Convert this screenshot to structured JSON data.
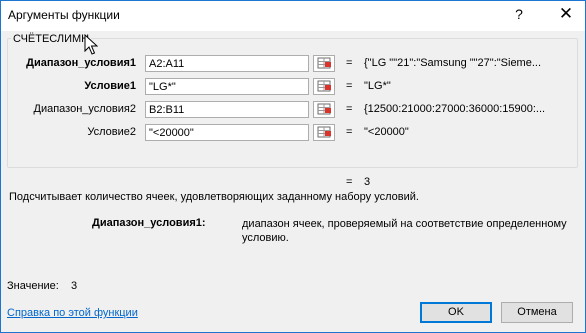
{
  "window": {
    "title": "Аргументы функции",
    "help_glyph": "?",
    "close_glyph": "✕"
  },
  "function": {
    "name": "СЧЁТЕСЛИМН"
  },
  "arguments": [
    {
      "label": "Диапазон_условия1",
      "bold": true,
      "input": "A2:A11",
      "eq": "=",
      "value": "{\"LG \"\"21\":\"Samsung \"\"27\":\"Sieme..."
    },
    {
      "label": "Условие1",
      "bold": true,
      "input": "\"LG*\"",
      "eq": "=",
      "value": "\"LG*\""
    },
    {
      "label": "Диапазон_условия2",
      "bold": false,
      "input": "B2:B11",
      "eq": "=",
      "value": "{12500:21000:27000:36000:15900:..."
    },
    {
      "label": "Условие2",
      "bold": false,
      "input": "\"<20000\"",
      "eq": "=",
      "value": "\"<20000\""
    }
  ],
  "result": {
    "eq": "=",
    "value": "3"
  },
  "description": "Подсчитывает количество ячеек, удовлетворяющих заданному набору условий.",
  "arg_description": {
    "label": "Диапазон_условия1:",
    "text": "диапазон ячеек, проверяемый на соответствие определенному условию."
  },
  "value_row": {
    "label": "Значение:",
    "value": "3"
  },
  "help_link": "Справка по этой функции",
  "buttons": {
    "ok": "OK",
    "cancel": "Отмена"
  },
  "colors": {
    "window_border": "#1e75d0",
    "link": "#0066cc",
    "ok_border": "#0078d7"
  }
}
